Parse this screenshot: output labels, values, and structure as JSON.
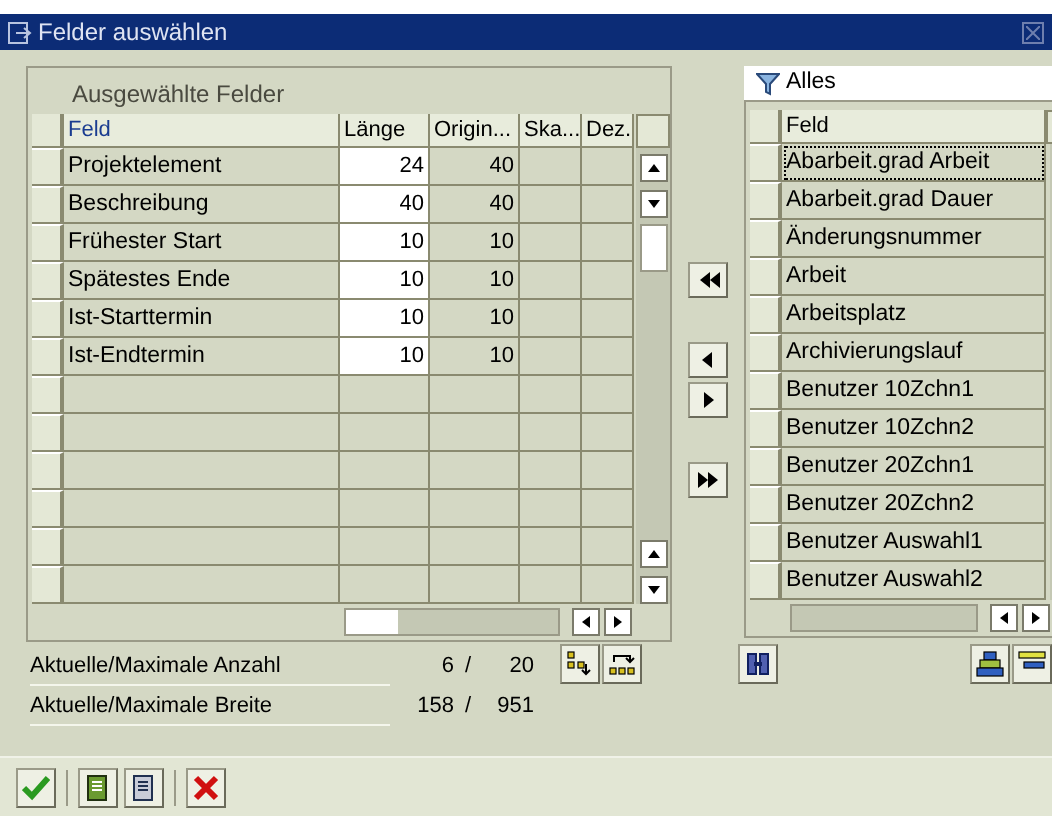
{
  "window": {
    "title": "Felder auswählen"
  },
  "selected_fields": {
    "title": "Ausgewählte Felder",
    "columns": [
      "Feld",
      "Länge",
      "Origin...",
      "Ska...",
      "Dez."
    ],
    "rows": [
      {
        "feld": "Projektelement",
        "laenge": "24",
        "original": "40"
      },
      {
        "feld": "Beschreibung",
        "laenge": "40",
        "original": "40"
      },
      {
        "feld": "Frühester Start",
        "laenge": "10",
        "original": "10"
      },
      {
        "feld": "Spätestes Ende",
        "laenge": "10",
        "original": "10"
      },
      {
        "feld": "Ist-Starttermin",
        "laenge": "10",
        "original": "10"
      },
      {
        "feld": "Ist-Endtermin",
        "laenge": "10",
        "original": "10"
      }
    ]
  },
  "available_fields": {
    "filter": "Alles",
    "column": "Feld",
    "rows": [
      {
        "feld": "Abarbeit.grad Arbeit",
        "focused": true
      },
      {
        "feld": "Abarbeit.grad Dauer",
        "focused": false
      },
      {
        "feld": "Änderungsnummer",
        "focused": false
      },
      {
        "feld": "Arbeit",
        "focused": false
      },
      {
        "feld": "Arbeitsplatz",
        "focused": false
      },
      {
        "feld": "Archivierungslauf",
        "focused": false
      },
      {
        "feld": "Benutzer 10Zchn1",
        "focused": false
      },
      {
        "feld": "Benutzer 10Zchn2",
        "focused": false
      },
      {
        "feld": "Benutzer 20Zchn1",
        "focused": false
      },
      {
        "feld": "Benutzer 20Zchn2",
        "focused": false
      },
      {
        "feld": "Benutzer Auswahl1",
        "focused": false
      },
      {
        "feld": "Benutzer Auswahl2",
        "focused": false
      }
    ]
  },
  "summary": [
    {
      "label": "Aktuelle/Maximale Anzahl",
      "current": "6",
      "separator": "/",
      "max": "20"
    },
    {
      "label": "Aktuelle/Maximale Breite",
      "current": "158",
      "separator": "/",
      "max": "951"
    }
  ]
}
